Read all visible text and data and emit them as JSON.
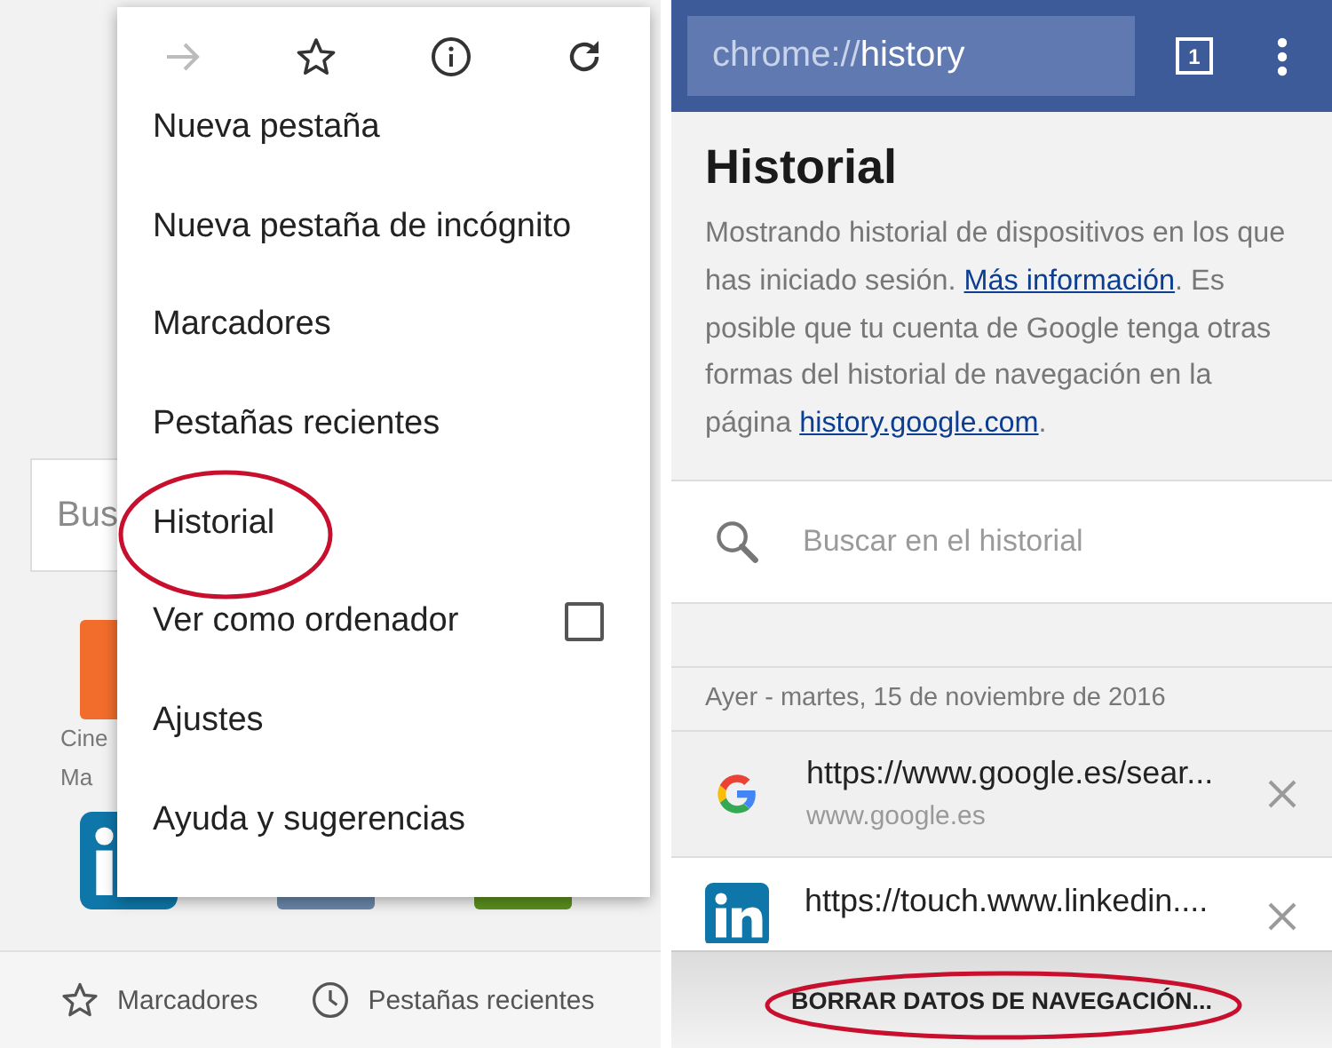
{
  "home_screen": {
    "search_placeholder": "Bus",
    "tiles": [
      {
        "kind": "square",
        "color": "#f26d2b",
        "label_lines": [
          "Cine",
          "Ma"
        ]
      },
      {
        "kind": "linkedin",
        "color": "#0e76a8"
      },
      {
        "kind": "square",
        "color": "#6a86a8"
      },
      {
        "kind": "square",
        "color": "#5a8f1e"
      }
    ],
    "bottom_bar": [
      {
        "kind": "star",
        "label": "Marcadores"
      },
      {
        "kind": "clock",
        "label": "Pestañas recientes"
      }
    ]
  },
  "menu": {
    "icons": [
      {
        "kind": "forward",
        "disabled": true
      },
      {
        "kind": "star",
        "disabled": false
      },
      {
        "kind": "info",
        "disabled": false
      },
      {
        "kind": "reload",
        "disabled": false
      }
    ],
    "items": [
      {
        "label": "Nueva pestaña",
        "circled": false
      },
      {
        "label": "Nueva pestaña de incógnito",
        "circled": false
      },
      {
        "label": "Marcadores",
        "circled": false
      },
      {
        "label": "Pestañas recientes",
        "circled": false
      },
      {
        "label": "Historial",
        "circled": true
      },
      {
        "label": "Ver como ordenador",
        "circled": false,
        "checked": false
      },
      {
        "label": "Ajustes",
        "circled": false
      },
      {
        "label": "Ayuda y sugerencias",
        "circled": false
      }
    ]
  },
  "history_page": {
    "address_bar": {
      "scheme": "chrome://",
      "path": "history"
    },
    "tab_count": "1",
    "title": "Historial",
    "description": [
      {
        "kind": "text",
        "text": "Mostrando historial de dispositivos en los que has iniciado sesión. "
      },
      {
        "kind": "link",
        "text": "Más información"
      },
      {
        "kind": "text",
        "text": ". Es posible que tu cuenta de Google tenga otras formas del historial de navegación en la página "
      },
      {
        "kind": "link",
        "text": "history.google.com"
      },
      {
        "kind": "text",
        "text": "."
      }
    ],
    "search": {
      "placeholder": "Buscar en el historial"
    },
    "date_header": "Ayer - martes, 15 de noviembre de 2016",
    "entries": [
      {
        "kind": "google",
        "title": "https://www.google.es/sear...",
        "domain": "www.google.es",
        "selected": true
      },
      {
        "kind": "linkedin",
        "title": "https://touch.www.linkedin....",
        "selected": false
      }
    ],
    "clear_button": {
      "label": "BORRAR DATOS DE NAVEGACIÓN...",
      "circled": true
    }
  }
}
